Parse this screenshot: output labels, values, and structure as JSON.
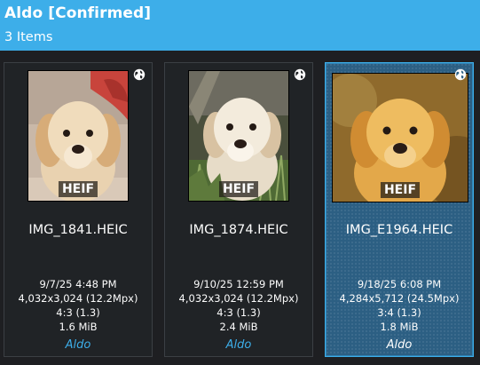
{
  "header": {
    "title": "Aldo [Confirmed]",
    "count": "3 Items"
  },
  "colors": {
    "accent": "#3daee9",
    "background": "#1e1f22",
    "card": "#202326",
    "selected_card": "#2c5f83"
  },
  "items": [
    {
      "filename": "IMG_1841.HEIC",
      "format_badge": "HEIF",
      "date": "9/7/25 4:48 PM",
      "dimensions": "4,032x3,024 (12.2Mpx)",
      "aspect": "4:3 (1.3)",
      "size": "1.6 MiB",
      "tag": "Aldo",
      "icon": "globe-icon",
      "selected": false
    },
    {
      "filename": "IMG_1874.HEIC",
      "format_badge": "HEIF",
      "date": "9/10/25 12:59 PM",
      "dimensions": "4,032x3,024 (12.2Mpx)",
      "aspect": "4:3 (1.3)",
      "size": "2.4 MiB",
      "tag": "Aldo",
      "icon": "globe-icon",
      "selected": false
    },
    {
      "filename": "IMG_E1964.HEIC",
      "format_badge": "HEIF",
      "date": "9/18/25 6:08 PM",
      "dimensions": "4,284x5,712 (24.5Mpx)",
      "aspect": "3:4 (1.3)",
      "size": "1.8 MiB",
      "tag": "Aldo",
      "icon": "globe-icon",
      "selected": true
    }
  ]
}
